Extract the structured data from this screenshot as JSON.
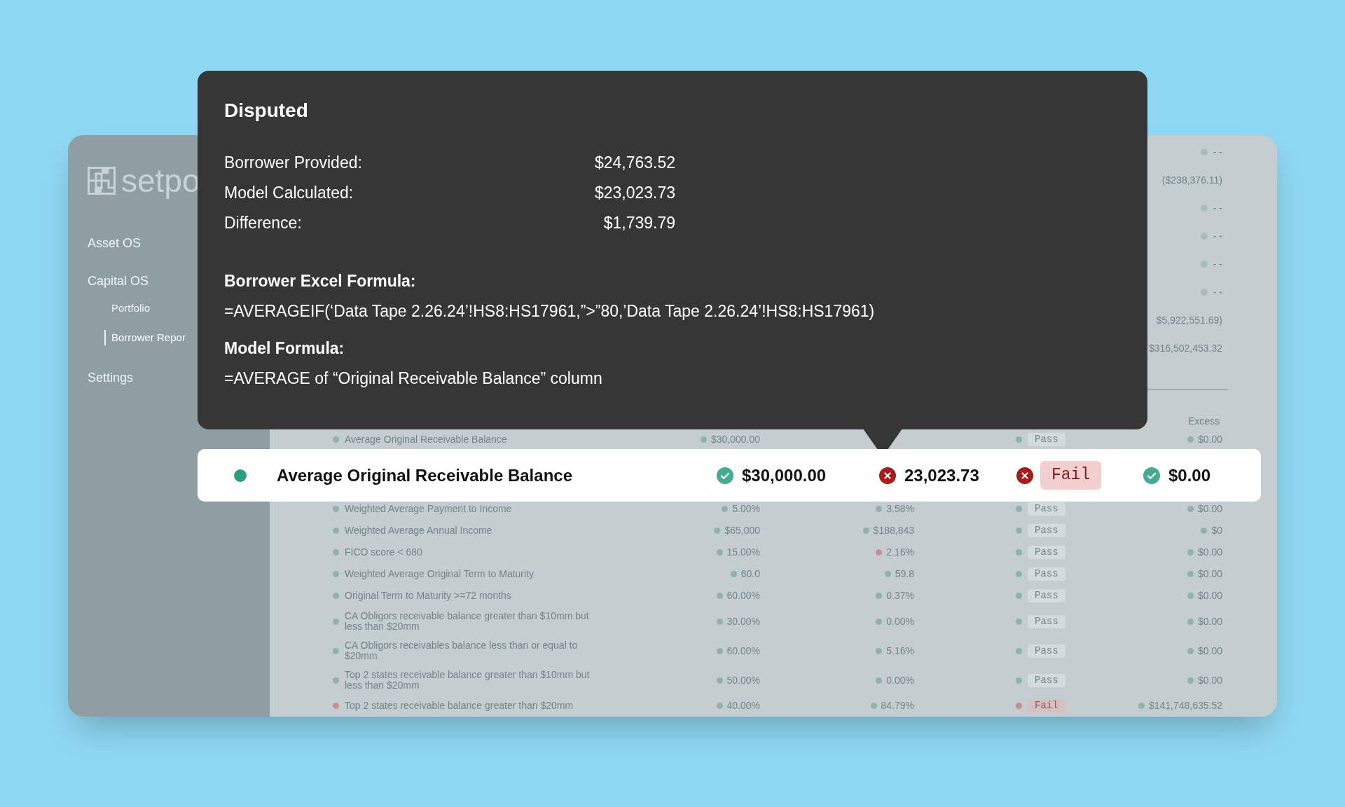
{
  "sidebar": {
    "logo": "setpo",
    "items": [
      {
        "label": "Asset OS",
        "selected": false
      },
      {
        "label": "Capital OS",
        "selected": false,
        "children": [
          {
            "label": "Portfolio",
            "selected": false
          },
          {
            "label": "Borrower Repor",
            "selected": true
          }
        ]
      },
      {
        "label": "Settings",
        "selected": false
      }
    ]
  },
  "summary": [
    {
      "kind": "dot",
      "text": "- -"
    },
    {
      "kind": "plain",
      "text": "($238,376.11)"
    },
    {
      "kind": "dot",
      "text": "- -"
    },
    {
      "kind": "dot",
      "text": "- -"
    },
    {
      "kind": "dot",
      "text": "- -"
    },
    {
      "kind": "dot",
      "text": "- -"
    },
    {
      "kind": "plain",
      "text": "$5,922,551.69)"
    },
    {
      "kind": "plain",
      "text": "$316,502,453.32"
    }
  ],
  "table": {
    "columns": [
      "Excess"
    ],
    "rows": [
      {
        "name": "Average Original Receivable Balance",
        "failed": false,
        "borrower": {
          "text": "$30,000.00",
          "failed": false
        },
        "result": {
          "text": "Pass",
          "failed": false
        },
        "excess": {
          "text": "$0.00",
          "failed": false
        }
      },
      {
        "name": "Weighted Average Payment to Income",
        "failed": false,
        "borrower": {
          "text": "5.00%",
          "failed": false
        },
        "model": {
          "text": "3.58%",
          "failed": false
        },
        "result": {
          "text": "Pass",
          "failed": false
        },
        "excess": {
          "text": "$0.00",
          "failed": false
        }
      },
      {
        "name": "Weighted Average Annual Income",
        "failed": false,
        "borrower": {
          "text": "$65,000",
          "failed": false
        },
        "model": {
          "text": "$188,843",
          "failed": false
        },
        "result": {
          "text": "Pass",
          "failed": false
        },
        "excess": {
          "text": "$0",
          "failed": false
        }
      },
      {
        "name": "FICO score < 680",
        "failed": false,
        "borrower": {
          "text": "15.00%",
          "failed": false
        },
        "model": {
          "text": "2.16%",
          "failed": true
        },
        "result": {
          "text": "Pass",
          "failed": false
        },
        "excess": {
          "text": "$0.00",
          "failed": false
        }
      },
      {
        "name": "Weighted Average Original Term to Maturity",
        "failed": false,
        "borrower": {
          "text": "60.0",
          "failed": false
        },
        "model": {
          "text": "59.8",
          "failed": false
        },
        "result": {
          "text": "Pass",
          "failed": false
        },
        "excess": {
          "text": "$0.00",
          "failed": false
        }
      },
      {
        "name": "Original Term to Maturity >=72 months",
        "failed": false,
        "borrower": {
          "text": "60.00%",
          "failed": false
        },
        "model": {
          "text": "0.37%",
          "failed": false
        },
        "result": {
          "text": "Pass",
          "failed": false
        },
        "excess": {
          "text": "$0.00",
          "failed": false
        }
      },
      {
        "name": "CA Obligors receivable balance greater than $10mm but less than $20mm",
        "failed": false,
        "borrower": {
          "text": "30.00%",
          "failed": false
        },
        "model": {
          "text": "0.00%",
          "failed": false
        },
        "result": {
          "text": "Pass",
          "failed": false
        },
        "excess": {
          "text": "$0.00",
          "failed": false
        }
      },
      {
        "name": "CA Obligors receivables balance less than or equal to $20mm",
        "failed": false,
        "borrower": {
          "text": "60.00%",
          "failed": false
        },
        "model": {
          "text": "5.16%",
          "failed": false
        },
        "result": {
          "text": "Pass",
          "failed": false
        },
        "excess": {
          "text": "$0.00",
          "failed": false
        }
      },
      {
        "name": "Top 2 states receivable balance greater than $10mm but less than $20mm",
        "failed": false,
        "borrower": {
          "text": "50.00%",
          "failed": false
        },
        "model": {
          "text": "0.00%",
          "failed": false
        },
        "result": {
          "text": "Pass",
          "failed": false
        },
        "excess": {
          "text": "$0.00",
          "failed": false
        }
      },
      {
        "name": "Top 2 states receivable balance greater than $20mm",
        "failed": true,
        "borrower": {
          "text": "40.00%",
          "failed": false
        },
        "model": {
          "text": "84.79%",
          "failed": false
        },
        "result": {
          "text": "Fail",
          "failed": true
        },
        "excess": {
          "text": "$141,748,635.52",
          "failed": false
        }
      }
    ]
  },
  "tooltip": {
    "title": "Disputed",
    "figures": [
      {
        "label": "Borrower Provided:",
        "value": "$24,763.52"
      },
      {
        "label": "Model Calculated:",
        "value": "$23,023.73"
      },
      {
        "label": "Difference:",
        "value": "$1,739.79"
      }
    ],
    "formulas": [
      {
        "heading": "Borrower Excel Formula:",
        "formula": "=AVERAGEIF(‘Data Tape 2.26.24’!HS8:HS17961,”>”80,’Data Tape 2.26.24’!HS8:HS17961)"
      },
      {
        "heading": "Model Formula:",
        "formula": "=AVERAGE of “Original Receivable Balance” column"
      }
    ]
  },
  "highlight_row": {
    "name": "Average Original Receivable Balance",
    "failed": false,
    "borrower": {
      "text": "$30,000.00",
      "failed": false
    },
    "model": {
      "text": "23,023.73",
      "failed": true
    },
    "result": {
      "text": "Fail",
      "failed": true
    },
    "excess": {
      "text": "$0.00",
      "failed": false
    }
  }
}
